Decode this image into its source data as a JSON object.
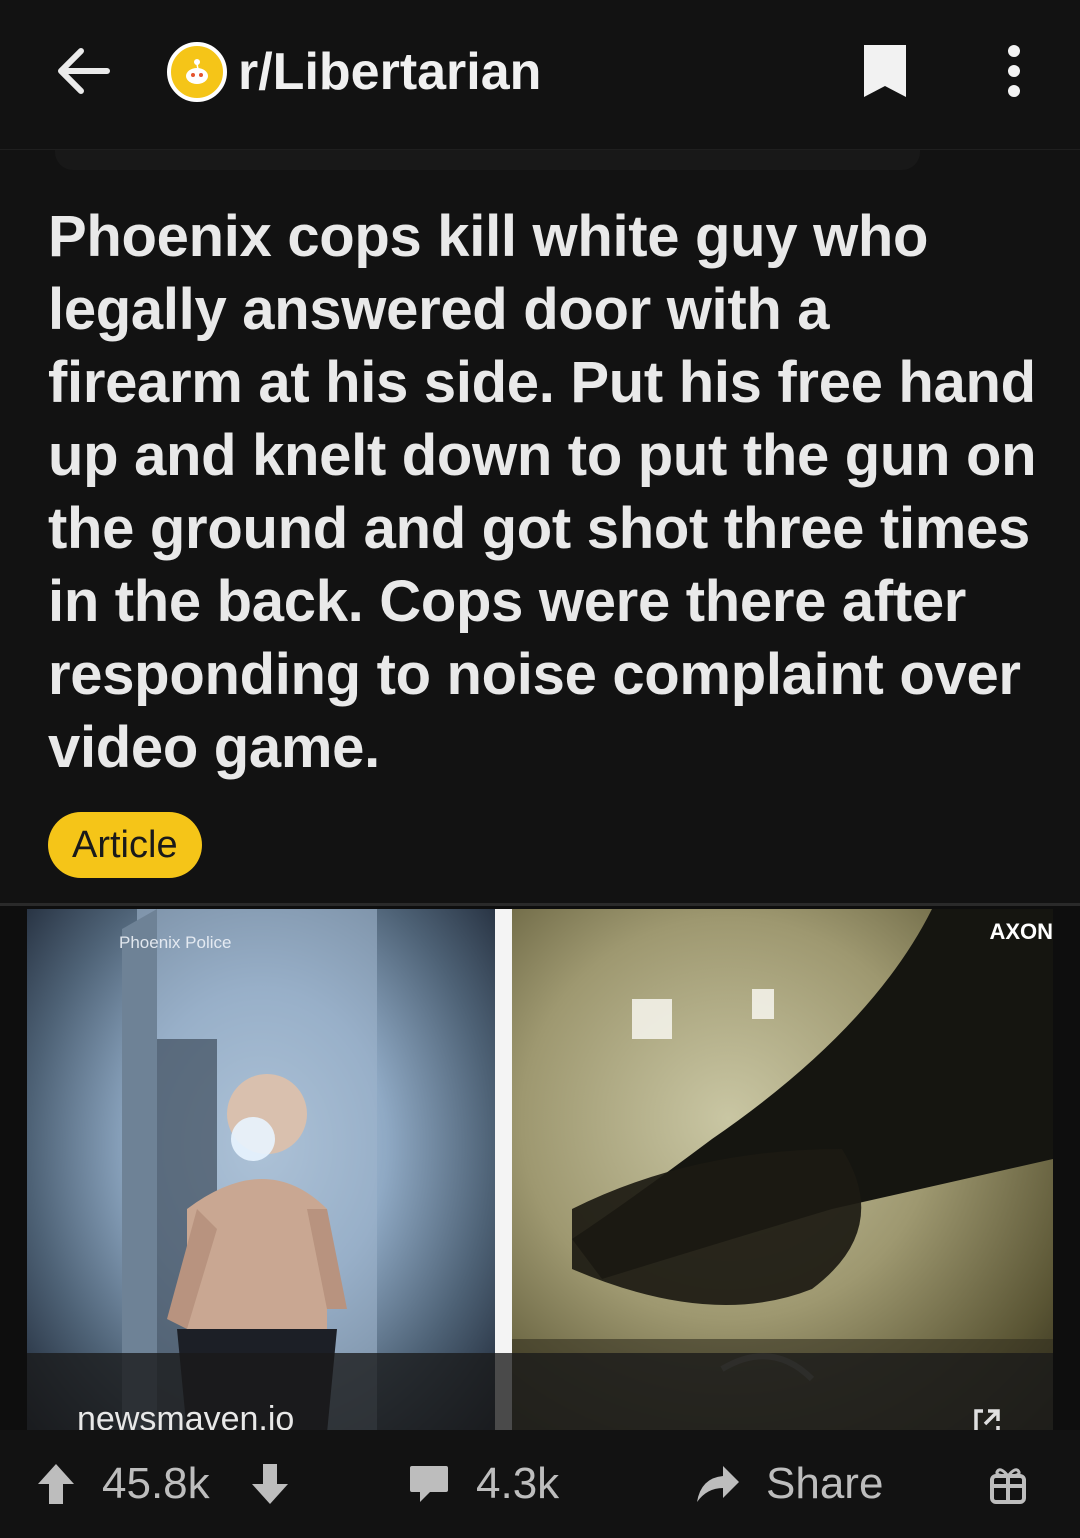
{
  "header": {
    "subreddit": "r/Libertarian",
    "back_icon": "back-arrow-icon",
    "bookmark_icon": "bookmark-icon",
    "more_icon": "more-vertical-icon"
  },
  "post": {
    "title": "Phoenix cops kill white guy who legally answered door with a firearm at his side. Put his free hand up and knelt down to put the gun on the ground and got shot three times in the back. Cops were there after responding to noise complaint over video game.",
    "flair": "Article",
    "flair_color": "#f5c518"
  },
  "article": {
    "watermark_left": "Phoenix Police",
    "watermark_right": "AXON",
    "domain": "newsmaven.io",
    "external_icon": "external-link-icon"
  },
  "actions": {
    "score": "45.8k",
    "comments": "4.3k",
    "share": "Share"
  }
}
